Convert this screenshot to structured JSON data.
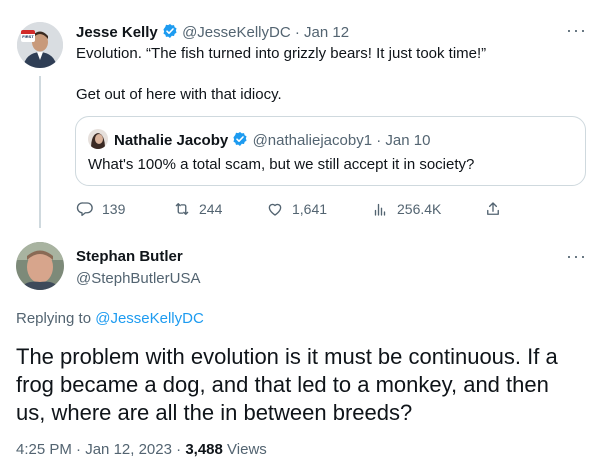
{
  "tweet1": {
    "name": "Jesse Kelly",
    "handle": "@JesseKellyDC",
    "dot": "·",
    "date": "Jan 12",
    "text_line1": "Evolution. “The fish turned into grizzly bears! It just took time!”",
    "text_line2": "Get out of here with that idiocy.",
    "avatar_badge": "FIRST",
    "more": "···"
  },
  "quote": {
    "name": "Nathalie Jacoby",
    "handle": "@nathaliejacoby1",
    "dot": "·",
    "date": "Jan 10",
    "text": "What's 100% a total scam, but we still accept it in society?"
  },
  "actions": {
    "reply_count": "139",
    "retweet_count": "244",
    "like_count": "1,641",
    "views_count": "256.4K"
  },
  "tweet2": {
    "name": "Stephan Butler",
    "handle": "@StephButlerUSA",
    "more": "···",
    "replying_label": "Replying to",
    "replying_handle": "@JesseKellyDC",
    "text_line1": "The problem with evolution is it must be continuous. If a",
    "text_line2": "frog became a dog, and that led to a monkey, and then",
    "text_line3": "us, where are all the in between breeds?",
    "time": "4:25 PM",
    "dot1": "·",
    "date": "Jan 12, 2023",
    "dot2": "·",
    "views_count": "3,488",
    "views_label": "Views"
  },
  "colors": {
    "accent": "#1d9bf0",
    "text": "#0f1419",
    "muted": "#536471",
    "border": "#cfd9de"
  }
}
